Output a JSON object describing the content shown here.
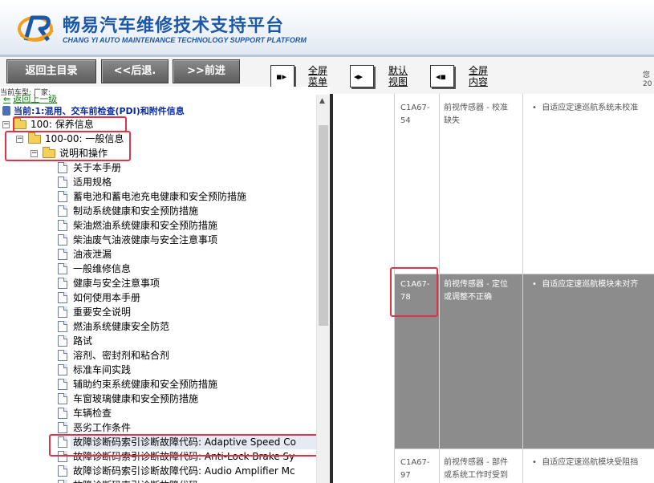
{
  "header": {
    "title": "畅易汽车维修技术支持平台",
    "subtitle": "CHANG YI AUTO MAINTENANCE TECHNOLOGY SUPPORT PLATFORM"
  },
  "toolbar": {
    "home_label": "返回主目录",
    "back_label": "<<后退.",
    "forward_label": ">>前进",
    "full_menu_line1": "全屏",
    "full_menu_line2": "菜单",
    "default_view_line1": "默认",
    "default_view_line2": "视图",
    "full_content_line1": "全屏",
    "full_content_line2": "内容",
    "edge_text_1": "您",
    "edge_text_2": "20"
  },
  "tree": {
    "current_model": "当前车型:  厂家:",
    "back_up": "返回上一级",
    "breadcrumb": "当前:1:混用、交车前检查(PDI)和附件信息",
    "level1": "100: 保养信息",
    "level2": "100-00: 一般信息",
    "level3": "说明和操作",
    "items": [
      "关于本手册",
      "适用规格",
      "蓄电池和蓄电池充电健康和安全预防措施",
      "制动系统健康和安全预防措施",
      "柴油燃油系统健康和安全预防措施",
      "柴油废气油液健康与安全注意事项",
      "油液泄漏",
      "一般维修信息",
      "健康与安全注意事项",
      "如何使用本手册",
      "重要安全说明",
      "燃油系统健康安全防范",
      "路试",
      "溶剂、密封剂和粘合剂",
      "标准车间实践",
      "辅助约束系统健康和安全预防措施",
      "车窗玻璃健康和安全预防措施",
      "车辆检查",
      "恶劣工作条件",
      "故障诊断码索引诊断故障代码: Adaptive Speed Co",
      "故障诊断码索引诊断故障代码: Anti-Lock Brake Sy",
      "故障诊断码索引诊断故障代码: Audio Amplifier Mc",
      "故障诊断码索引诊断故障代码: ..."
    ]
  },
  "content": {
    "rows": [
      {
        "code_1": "C1A67-",
        "code_2": "54",
        "desc_1": "前视传感器 - 校准",
        "desc_2": "缺失",
        "info": "自适应定速巡航系统未校准"
      },
      {
        "code_1": "C1A67-",
        "code_2": "78",
        "desc_1": "前视传感器 - 定位",
        "desc_2": "或调整不正确",
        "info": "自适应定速巡航模块未对齐"
      },
      {
        "code_1": "C1A67-",
        "code_2": "97",
        "desc_1": "前视传感器 - 部件",
        "desc_2": "或系统工作时受到",
        "info": "自适应定速巡航模块受阻挡"
      }
    ],
    "bullet": "•"
  }
}
